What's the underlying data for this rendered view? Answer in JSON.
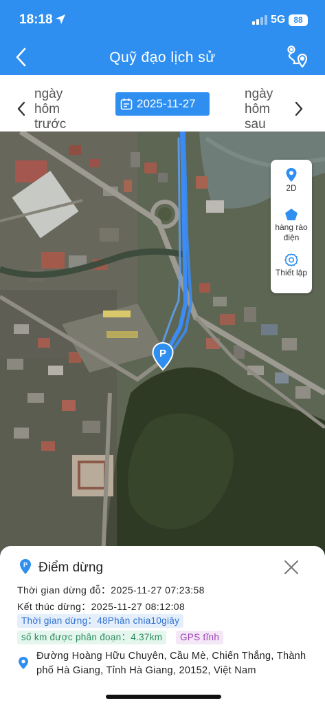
{
  "status_bar": {
    "time": "18:18",
    "network": "5G",
    "battery": "88"
  },
  "header": {
    "title": "Quỹ đạo lịch sử",
    "back_icon": "chevron-left-icon",
    "route_icon": "route-icon",
    "background": "#2f8ff0"
  },
  "date_nav": {
    "prev_label": "ngày hôm trước",
    "next_label": "ngày hôm sau",
    "date": "2025-11-27"
  },
  "map_tools": [
    {
      "label": "2D",
      "icon": "map-pin-icon"
    },
    {
      "label": "hàng rào điện",
      "icon": "fence-pentagon-icon"
    },
    {
      "label": "Thiết lập",
      "icon": "settings-gear-icon"
    }
  ],
  "map": {
    "track_color": "#3b8cf5",
    "marker_label": "P"
  },
  "stop_info": {
    "title": "Điểm dừng",
    "stop_start": "Thời gian dừng đỗ：2025-11-27 07:23:58",
    "stop_end": "Kết thúc dừng：2025-11-27 08:12:08",
    "duration": "Thời gian dừng：48Phân chia10giây",
    "distance": "số km được phân đoạn：4.37km",
    "gps": "GPS tĩnh",
    "address": "Đường Hoàng Hữu Chuyên, Cầu Mè, Chiến Thắng, Thành phố Hà Giang, Tỉnh Hà Giang, 20152, Việt Nam"
  }
}
